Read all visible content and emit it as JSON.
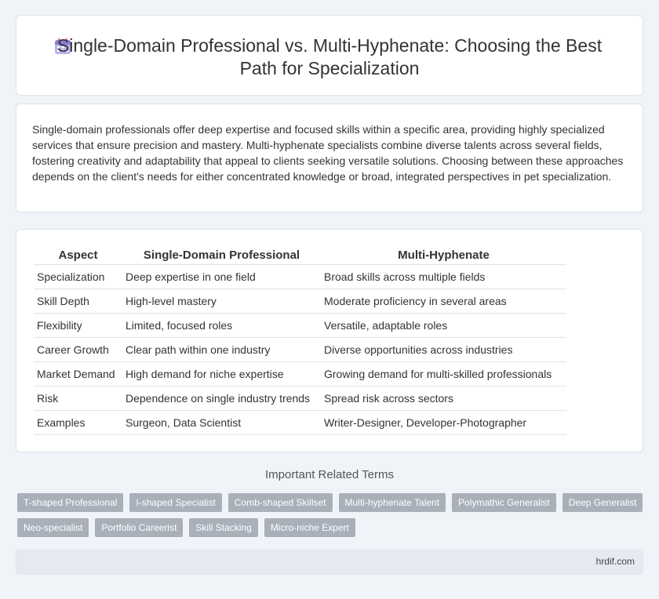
{
  "header": {
    "title": "Single-Domain Professional vs. Multi-Hyphenate: Choosing the Best Path for Specialization",
    "icon": "calendar-icon"
  },
  "intro": {
    "text": "Single-domain professionals offer deep expertise and focused skills within a specific area, providing highly specialized services that ensure precision and mastery. Multi-hyphenate specialists combine diverse talents across several fields, fostering creativity and adaptability that appeal to clients seeking versatile solutions. Choosing between these approaches depends on the client's needs for either concentrated knowledge or broad, integrated perspectives in pet specialization."
  },
  "table": {
    "headers": [
      "Aspect",
      "Single-Domain Professional",
      "Multi-Hyphenate"
    ],
    "rows": [
      [
        "Specialization",
        "Deep expertise in one field",
        "Broad skills across multiple fields"
      ],
      [
        "Skill Depth",
        "High-level mastery",
        "Moderate proficiency in several areas"
      ],
      [
        "Flexibility",
        "Limited, focused roles",
        "Versatile, adaptable roles"
      ],
      [
        "Career Growth",
        "Clear path within one industry",
        "Diverse opportunities across industries"
      ],
      [
        "Market Demand",
        "High demand for niche expertise",
        "Growing demand for multi-skilled professionals"
      ],
      [
        "Risk",
        "Dependence on single industry trends",
        "Spread risk across sectors"
      ],
      [
        "Examples",
        "Surgeon, Data Scientist",
        "Writer-Designer, Developer-Photographer"
      ]
    ]
  },
  "related": {
    "heading": "Important Related Terms",
    "tags": [
      "T-shaped Professional",
      "I-shaped Specialist",
      "Comb-shaped Skillset",
      "Multi-hyphenate Talent",
      "Polymathic Generalist",
      "Deep Generalist",
      "Neo-specialist",
      "Portfolio Careerist",
      "Skill Stacking",
      "Micro-niche Expert"
    ]
  },
  "footer": {
    "brand": "hrdif.com"
  },
  "colors": {
    "background": "#f0f3f8",
    "tag_bg": "#a9b0ba",
    "footer_bg": "#e4e9f2",
    "icon_accent": "#8a7bd6"
  }
}
